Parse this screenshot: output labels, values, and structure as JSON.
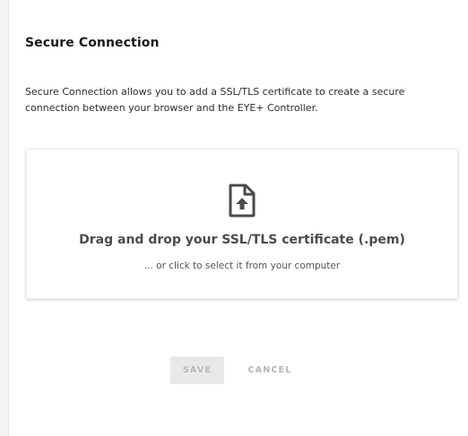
{
  "section": {
    "title": "Secure Connection",
    "description": "Secure Connection allows you to add a SSL/TLS certificate to create a secure connection between your browser and the EYE+ Controller."
  },
  "dropzone": {
    "icon": "file-upload-icon",
    "title": "Drag and drop your SSL/TLS certificate (.pem)",
    "subtitle": "... or click to select it from your computer"
  },
  "actions": {
    "save_label": "SAVE",
    "save_disabled": true,
    "cancel_label": "CANCEL"
  }
}
